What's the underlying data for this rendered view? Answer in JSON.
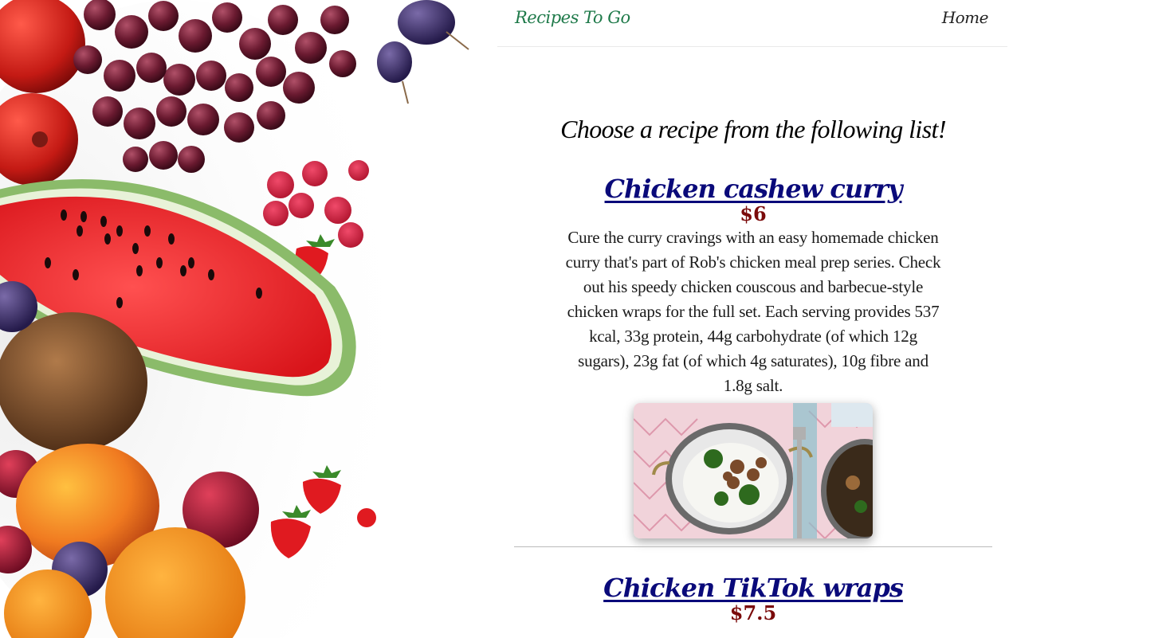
{
  "header": {
    "brand": "Recipes To Go",
    "nav": {
      "home_label": "Home"
    }
  },
  "main": {
    "title": "Choose a recipe from the following list!",
    "recipes": [
      {
        "title": "Chicken cashew curry",
        "price": "$6",
        "description": "Cure the curry cravings with an easy homemade chicken curry that's part of Rob's chicken meal prep series. Check out his speedy chicken couscous and barbecue-style chicken wraps for the full set. Each serving provides 537 kcal, 33g protein, 44g carbohydrate (of which 12g sugars), 23g fat (of which 4g saturates), 10g fibre and 1.8g salt.",
        "image": "chicken-curry-photo"
      },
      {
        "title": "Chicken TikTok wraps",
        "price": "$7.5",
        "description": ""
      }
    ]
  },
  "colors": {
    "brand": "#1f7a4a",
    "link": "#0a0a7a",
    "price": "#7a0a0a",
    "divider": "#bbbbbb"
  }
}
